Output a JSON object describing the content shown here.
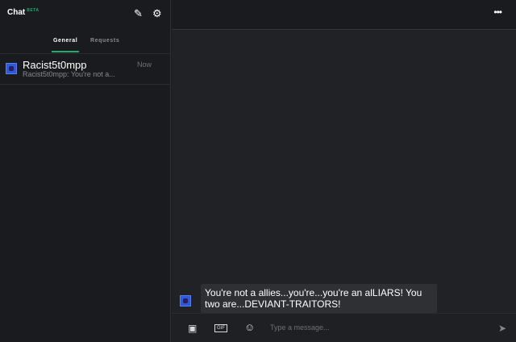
{
  "sidebar": {
    "title": "Chat",
    "badge": "BETA",
    "tabs": [
      {
        "label": "General"
      },
      {
        "label": "Requests"
      }
    ],
    "conversations": [
      {
        "name": "Racist5t0mpp",
        "preview": "Racist5t0mpp: You're not a...",
        "time": "Now"
      }
    ]
  },
  "chat": {
    "messages": [
      {
        "text": "You're not a allies...you're...you're an alLIARS! You two are...DEVIANT-TRAITORS!"
      }
    ],
    "input": {
      "placeholder": "Type a message..."
    }
  },
  "icons": {
    "gif": "GIF"
  }
}
